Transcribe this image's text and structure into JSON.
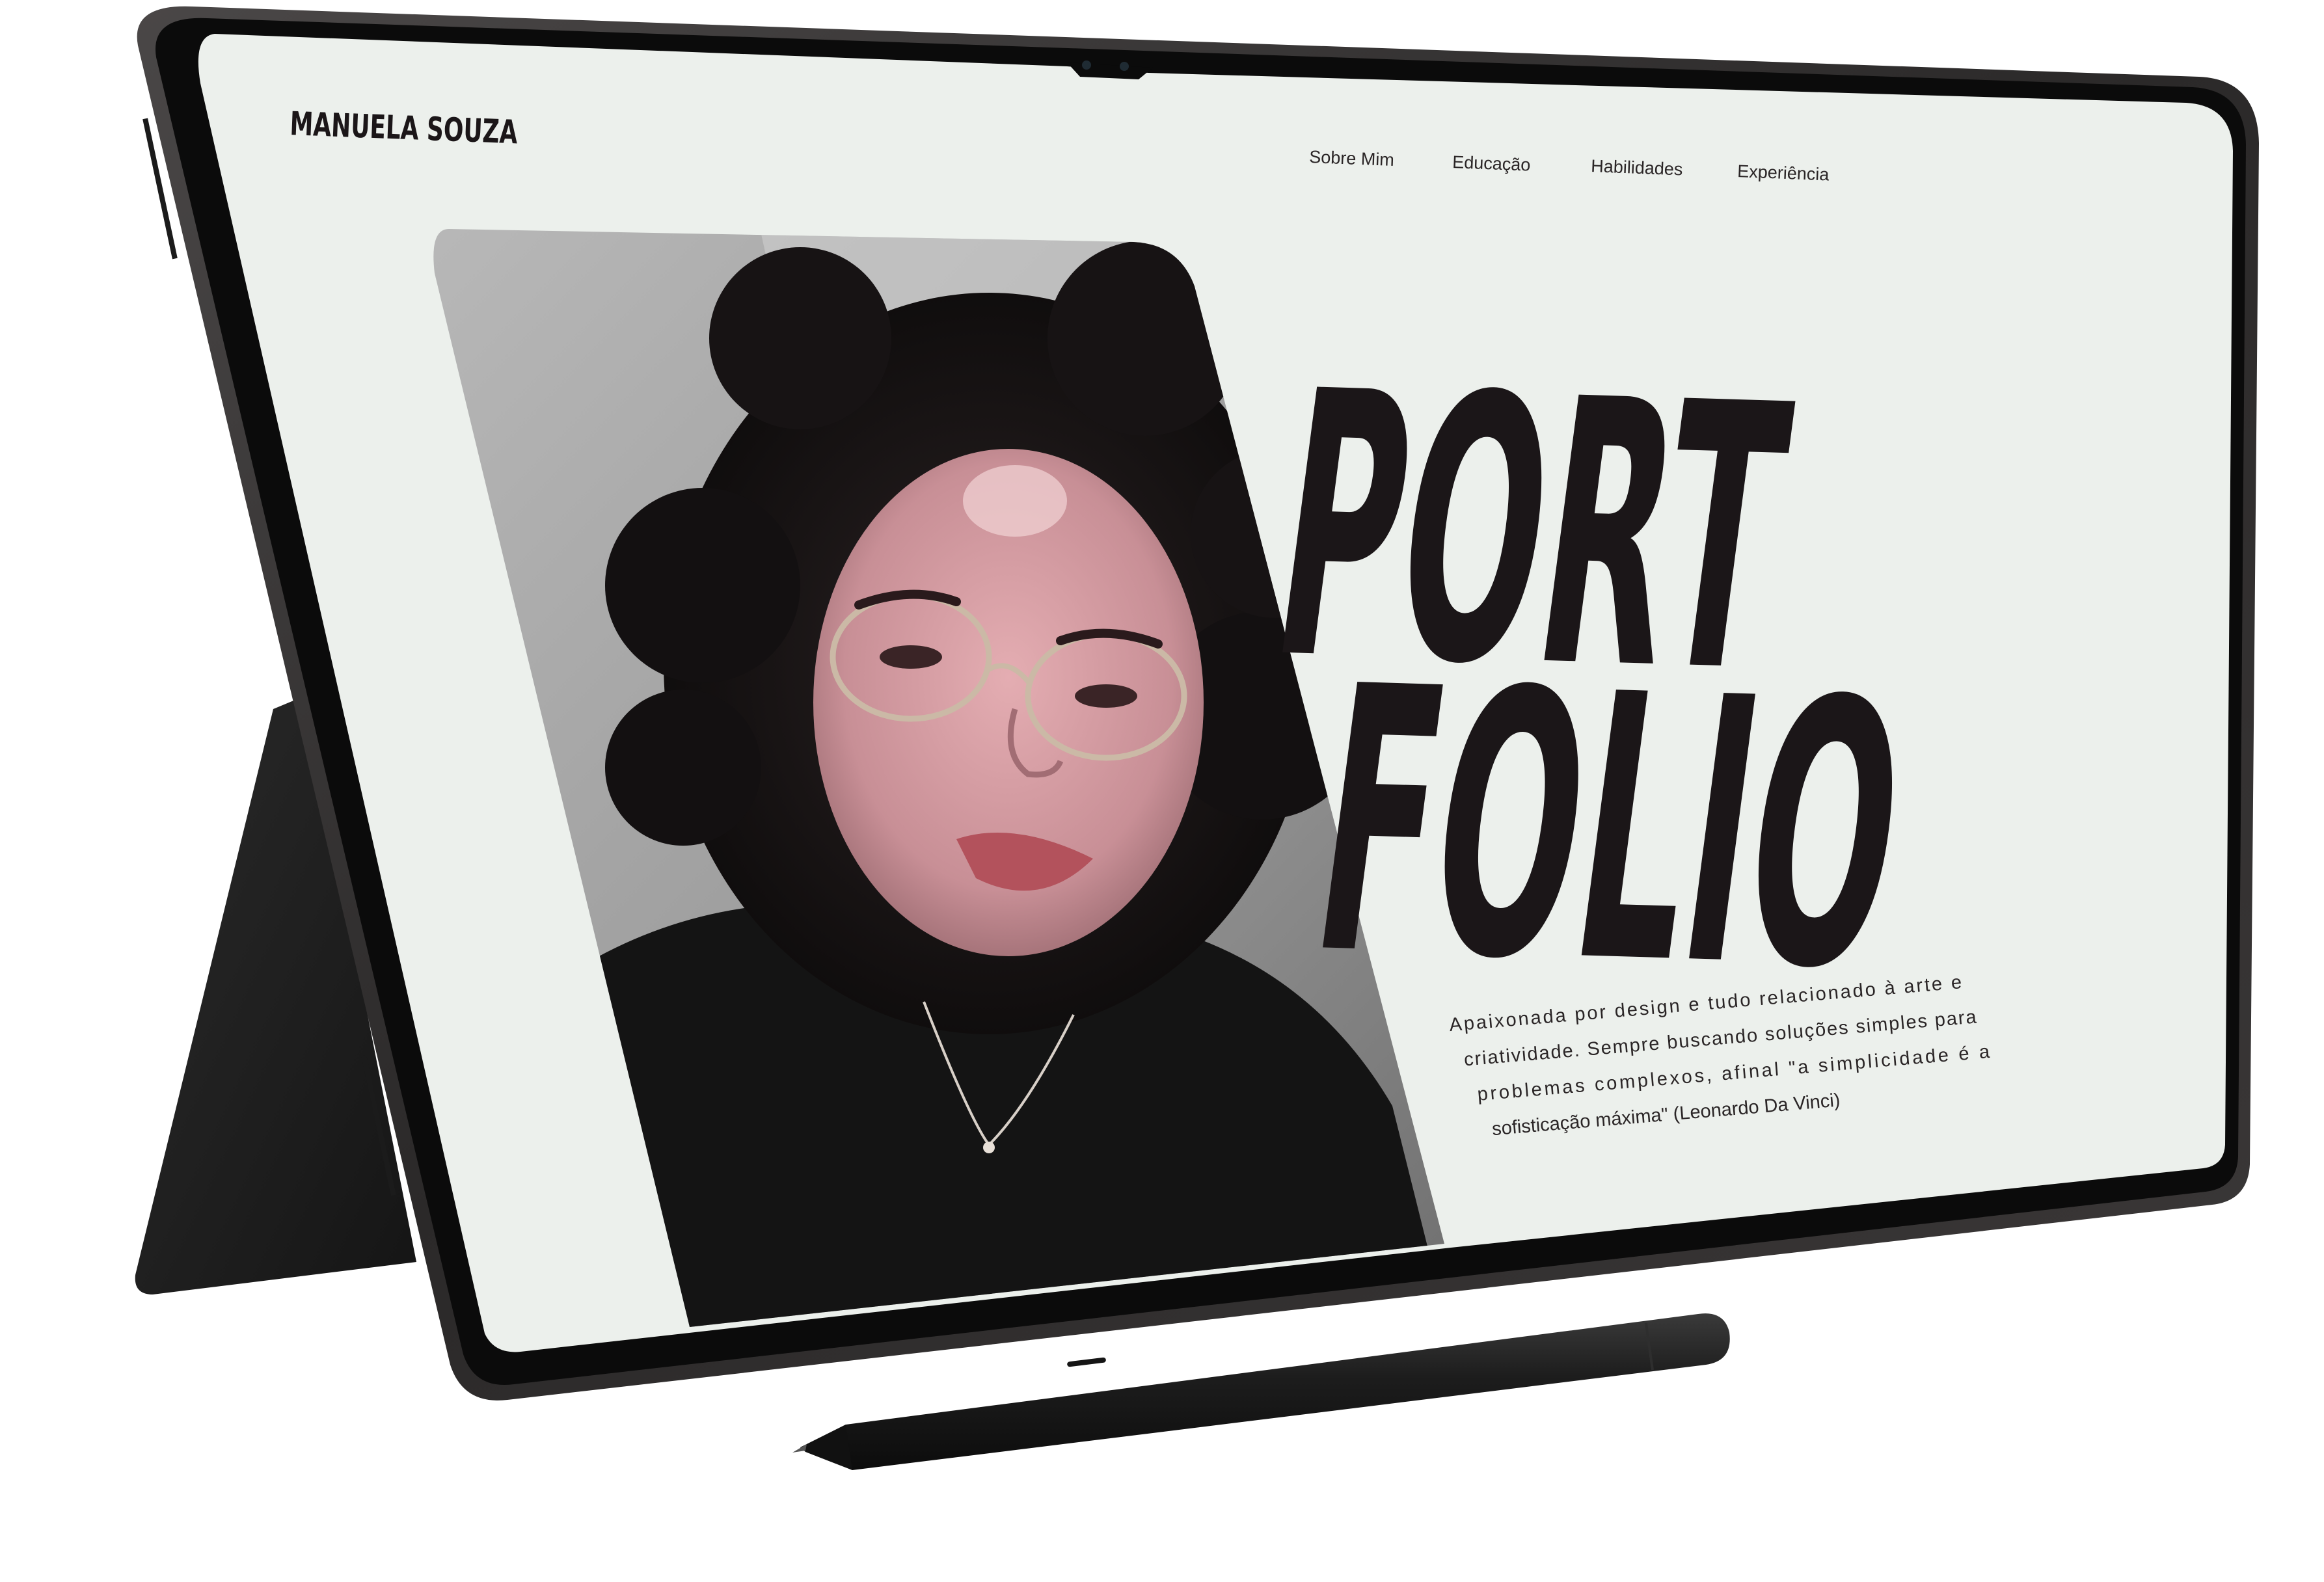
{
  "site": {
    "brand": "MANUELA SOUZA"
  },
  "nav": {
    "items": [
      {
        "label": "Sobre Mim"
      },
      {
        "label": "Educação"
      },
      {
        "label": "Habilidades"
      },
      {
        "label": "Experiência"
      }
    ]
  },
  "hero": {
    "title_line1": "PORT",
    "title_line2": "FOLIO",
    "bio_lines": [
      "Apaixonada  por  design  e  tudo  relacionado  à  arte  e",
      "criatividade.  Sempre  buscando  soluções  simples  para",
      "problemas    complexos,    afinal   \"a   simplicidade   é   a",
      "sofisticação máxima\" (Leonardo Da Vinci)"
    ]
  },
  "colors": {
    "screen_bg": "#ecf0ec",
    "text_dark": "#1b1618",
    "device_frame": "#2d2b2b",
    "bezel": "#0c0c0c"
  }
}
